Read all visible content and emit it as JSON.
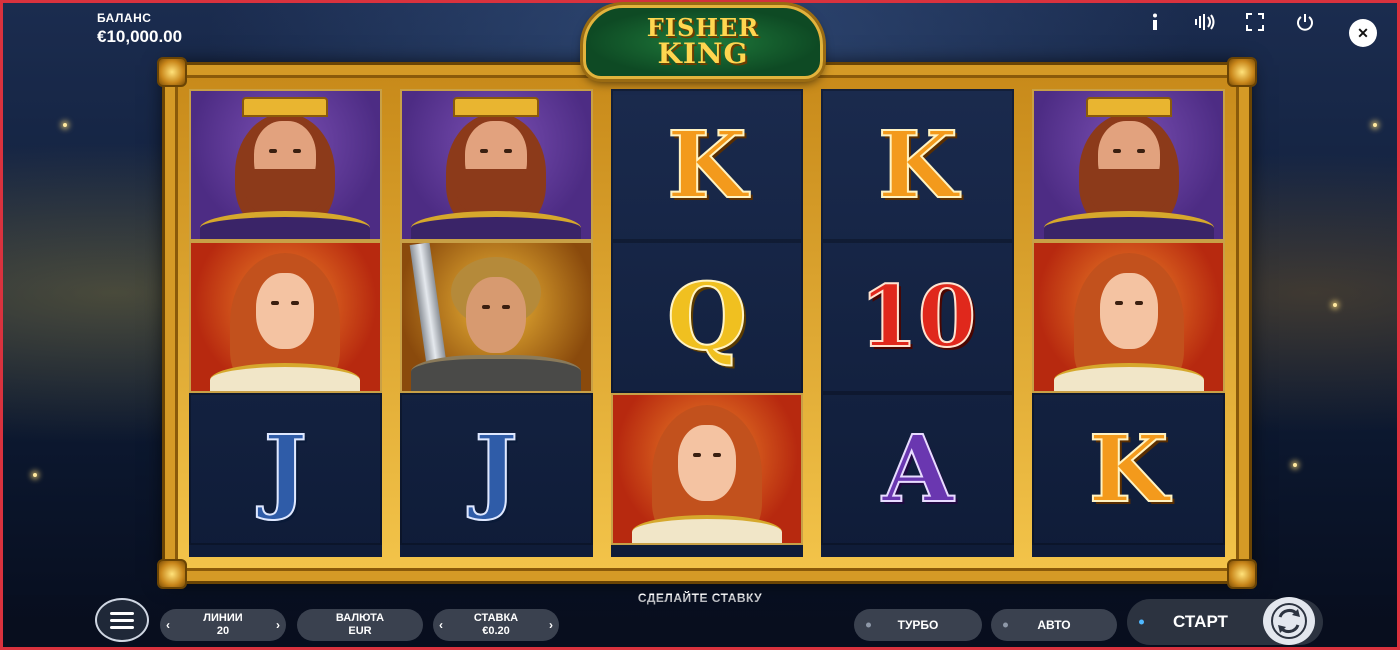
{
  "balance": {
    "label": "БАЛАНС",
    "value": "€10,000.00"
  },
  "logo": {
    "line1": "FISHER",
    "line2": "KING"
  },
  "top_icons": [
    "info-icon",
    "sound-icon",
    "fullscreen-icon",
    "power-icon"
  ],
  "close_label": "✕",
  "reels": [
    [
      "king",
      "lady",
      "J"
    ],
    [
      "king",
      "knight",
      "J"
    ],
    [
      "K",
      "Q",
      "lady"
    ],
    [
      "K",
      "10",
      "A"
    ],
    [
      "king",
      "lady",
      "K"
    ]
  ],
  "prompt": "СДЕЛАЙТЕ СТАВКУ",
  "controls": {
    "lines": {
      "label": "ЛИНИИ",
      "value": "20"
    },
    "currency": {
      "label": "ВАЛЮТА",
      "value": "EUR"
    },
    "bet": {
      "label": "СТАВКА",
      "value": "€0.20"
    },
    "turbo": "ТУРБО",
    "auto": "АВТО",
    "start": "СТАРТ"
  },
  "colors": {
    "frame_gold": "#d59a26",
    "border_red": "#d9323e",
    "accent_blue": "#4fb8ff"
  }
}
